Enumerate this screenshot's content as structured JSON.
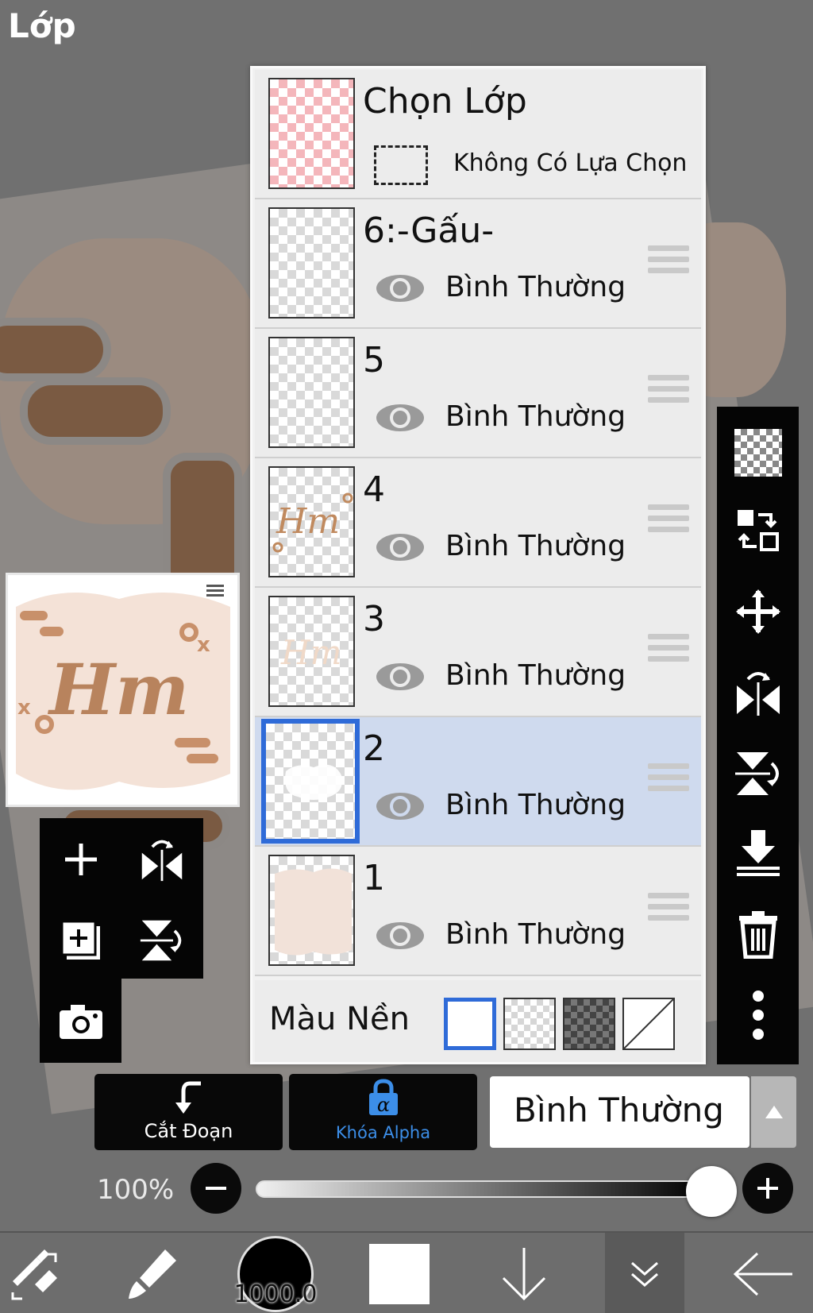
{
  "title": "Lớp",
  "selection_row": {
    "label": "Chọn Lớp",
    "status": "Không Có Lựa Chọn"
  },
  "layers": [
    {
      "name": "6:-Gấu-",
      "blend": "Bình Thường",
      "selected": false
    },
    {
      "name": "5",
      "blend": "Bình Thường",
      "selected": false
    },
    {
      "name": "4",
      "blend": "Bình Thường",
      "selected": false
    },
    {
      "name": "3",
      "blend": "Bình Thường",
      "selected": false
    },
    {
      "name": "2",
      "blend": "Bình Thường",
      "selected": true
    },
    {
      "name": "1",
      "blend": "Bình Thường",
      "selected": false
    }
  ],
  "background_row": {
    "label": "Màu Nền",
    "options": [
      "white",
      "transparent-checker",
      "dark-checker",
      "none"
    ],
    "selected": "white"
  },
  "actions": {
    "clip_label": "Cắt Đoạn",
    "alpha_lock_label": "Khóa Alpha",
    "blend_mode_value": "Bình Thường"
  },
  "opacity": {
    "label": "100%",
    "value": 1.0
  },
  "bottom_nav": {
    "brush_size": "1000.0"
  },
  "colors": {
    "accent_blue": "#2f6bd8",
    "selected_row": "#cfdaee",
    "alpha_lock_blue": "#3c8ee8",
    "toolbar_black": "#050505"
  },
  "icons": {
    "right_toolbar": [
      "transparent-layer-icon",
      "layer-swap-icon",
      "move-icon",
      "flip-horizontal-icon",
      "flip-vertical-icon",
      "merge-down-icon",
      "trash-icon",
      "more-vertical-icon"
    ],
    "left_toolbar": [
      "add-layer-icon",
      "flip-horizontal-icon",
      "duplicate-layer-icon",
      "flip-vertical-icon",
      "camera-icon"
    ],
    "bottom_nav": [
      "swap-tools-icon",
      "brush-icon",
      "brush-size-icon",
      "color-swatch-icon",
      "arrow-down-icon",
      "chevron-double-down-icon",
      "back-arrow-icon"
    ]
  }
}
